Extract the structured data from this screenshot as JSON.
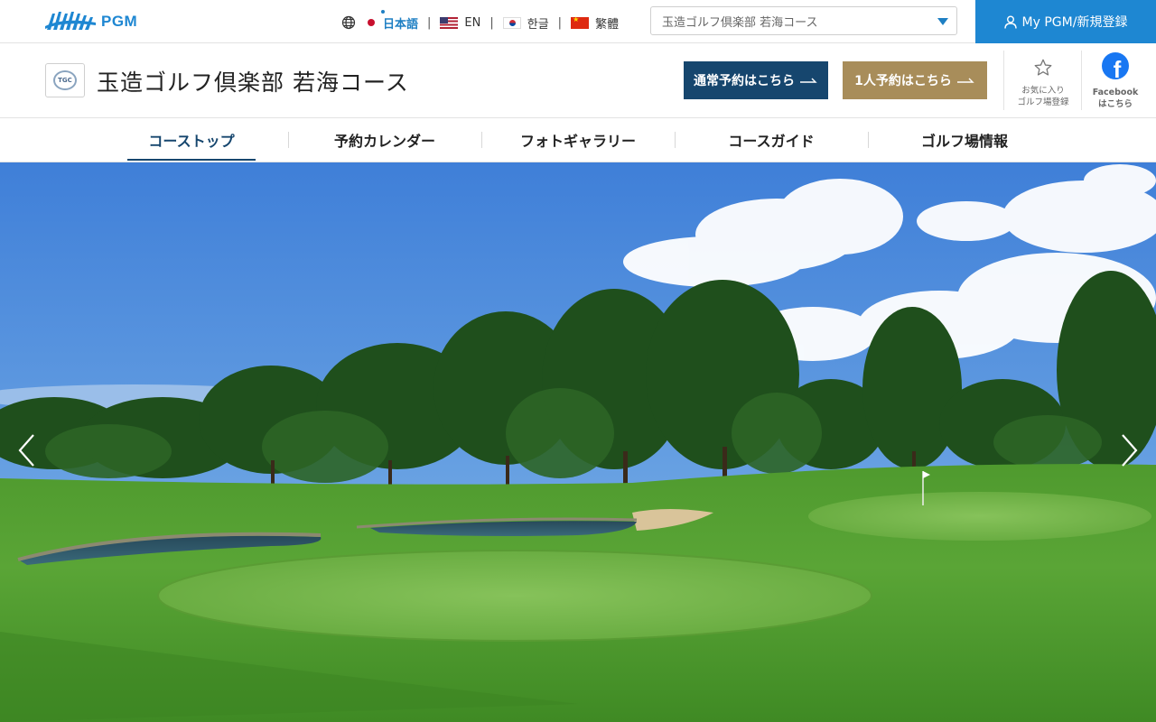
{
  "brand": {
    "logo_text": "PGM",
    "logo_mark_icon": "pgm-wave-logo"
  },
  "languages": [
    {
      "label": "日本語",
      "flag": "jp-flag-icon",
      "active": true
    },
    {
      "label": "EN",
      "flag": "us-flag-icon",
      "active": false
    },
    {
      "label": "한글",
      "flag": "kr-flag-icon",
      "active": false
    },
    {
      "label": "繁體",
      "flag": "cn-flag-icon",
      "active": false
    }
  ],
  "course_select": {
    "value": "玉造ゴルフ倶楽部 若海コース"
  },
  "account": {
    "label": "My PGM/新規登録"
  },
  "course": {
    "name": "玉造ゴルフ倶楽部 若海コース",
    "reserve_normal": "通常予約はこちら",
    "reserve_solo": "1人予約はこちら",
    "favorite_line1": "お気に入り",
    "favorite_line2": "ゴルフ場登録",
    "facebook_line1": "Facebook",
    "facebook_line2": "はこちら"
  },
  "nav": {
    "items": [
      {
        "label": "コーストップ",
        "active": true
      },
      {
        "label": "予約カレンダー",
        "active": false
      },
      {
        "label": "フォトギャラリー",
        "active": false
      },
      {
        "label": "コースガイド",
        "active": false
      },
      {
        "label": "ゴルフ場情報",
        "active": false
      }
    ]
  },
  "colors": {
    "brand_blue": "#1e87d2",
    "navy": "#16466e",
    "gold": "#a88d5a",
    "facebook": "#1877f2"
  }
}
